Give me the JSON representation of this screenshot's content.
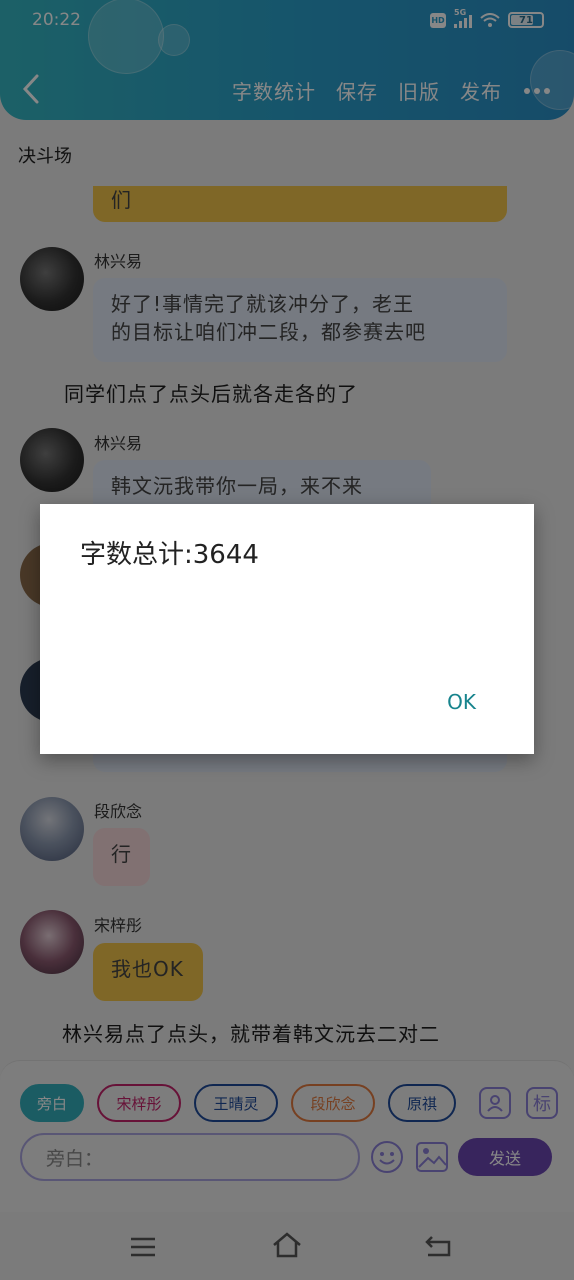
{
  "status": {
    "time": "20:22",
    "hd": "HD",
    "network": "5G",
    "battery": "71"
  },
  "header": {
    "back_icon": "chevron-left-icon",
    "menu": [
      "字数统计",
      "保存",
      "旧版",
      "发布"
    ],
    "more_icon": "more-dots-icon"
  },
  "chapter_title": "决斗场",
  "chat": {
    "partial_bubble_text": "们",
    "messages": [
      {
        "name": "林兴易",
        "text_line1": "好了!事情完了就该冲分了，老王",
        "text_line2": "的目标让咱们冲二段，都参赛去吧"
      },
      {
        "name": "林兴易",
        "text_line1": "韩文沅我带你一局，来不来"
      },
      {
        "name": "段欣念",
        "text_line1": "行"
      },
      {
        "name": "宋梓彤",
        "text_line1": "我也OK"
      }
    ],
    "narration1": "同学们点了点头后就各走各的了",
    "narration2": "林兴易点了点头，就带着韩文沅去二对二"
  },
  "roles": {
    "chips": [
      "旁白",
      "宋梓彤",
      "王晴灵",
      "段欣念",
      "原祺"
    ],
    "colors": [
      "#33aebc",
      "#c2226a",
      "#1f4b9a",
      "#e07a3f",
      "#1f4b9a"
    ]
  },
  "input": {
    "placeholder": "旁白：",
    "send_label": "发送"
  },
  "bottom_icons": {
    "person": "person-icon",
    "tag": "标",
    "emoji": "emoji-icon",
    "image": "image-icon"
  },
  "dialog": {
    "message": "字数总计:3644",
    "ok_label": "OK"
  },
  "navbar": {
    "menu_icon": "menu-icon",
    "home_icon": "home-icon",
    "back_icon": "back-icon"
  }
}
